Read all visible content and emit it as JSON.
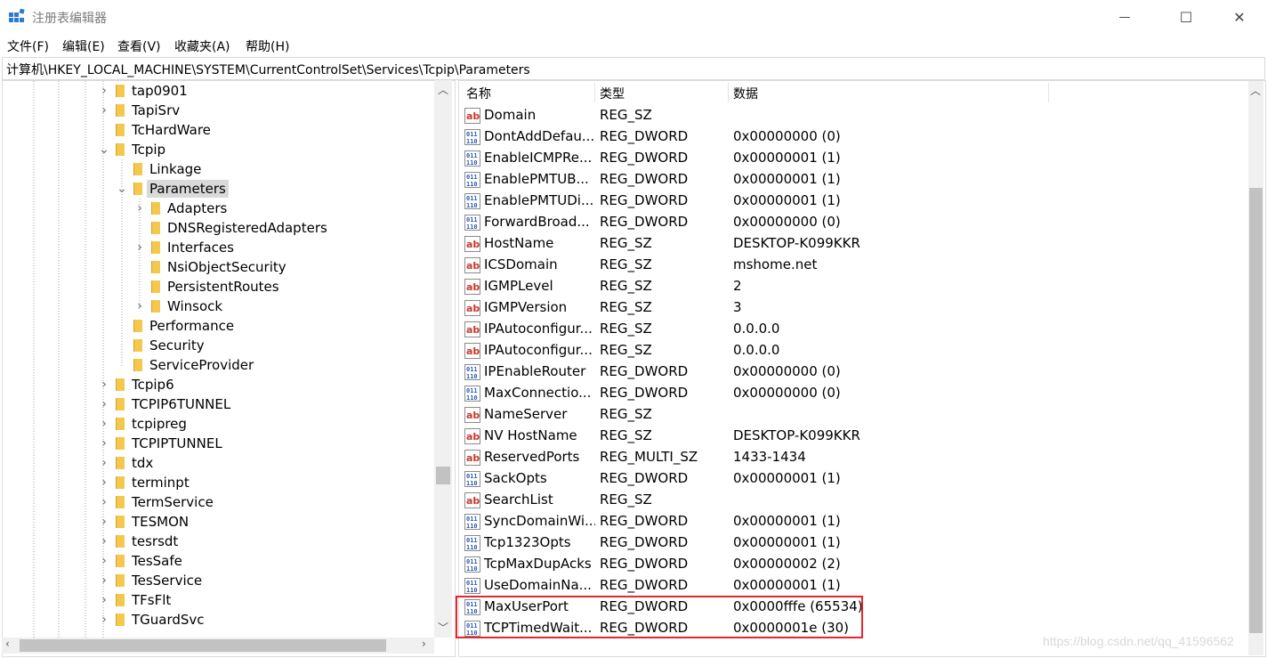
{
  "window": {
    "title": "注册表编辑器",
    "minimize_glyph": "—",
    "maximize_glyph": "☐",
    "close_glyph": "✕"
  },
  "menu": [
    "文件(F)",
    "编辑(E)",
    "查看(V)",
    "收藏夹(A)",
    "帮助(H)"
  ],
  "address": "计算机\\HKEY_LOCAL_MACHINE\\SYSTEM\\CurrentControlSet\\Services\\Tcpip\\Parameters",
  "tree": [
    {
      "label": "tap0901",
      "depth": 0,
      "expander": "collapsed"
    },
    {
      "label": "TapiSrv",
      "depth": 0,
      "expander": "collapsed"
    },
    {
      "label": "TcHardWare",
      "depth": 0,
      "expander": "none"
    },
    {
      "label": "Tcpip",
      "depth": 0,
      "expander": "expanded"
    },
    {
      "label": "Linkage",
      "depth": 1,
      "expander": "none"
    },
    {
      "label": "Parameters",
      "depth": 1,
      "expander": "expanded",
      "selected": true
    },
    {
      "label": "Adapters",
      "depth": 2,
      "expander": "collapsed"
    },
    {
      "label": "DNSRegisteredAdapters",
      "depth": 2,
      "expander": "none"
    },
    {
      "label": "Interfaces",
      "depth": 2,
      "expander": "collapsed"
    },
    {
      "label": "NsiObjectSecurity",
      "depth": 2,
      "expander": "none"
    },
    {
      "label": "PersistentRoutes",
      "depth": 2,
      "expander": "none"
    },
    {
      "label": "Winsock",
      "depth": 2,
      "expander": "collapsed"
    },
    {
      "label": "Performance",
      "depth": 1,
      "expander": "none"
    },
    {
      "label": "Security",
      "depth": 1,
      "expander": "none"
    },
    {
      "label": "ServiceProvider",
      "depth": 1,
      "expander": "none"
    },
    {
      "label": "Tcpip6",
      "depth": 0,
      "expander": "collapsed"
    },
    {
      "label": "TCPIP6TUNNEL",
      "depth": 0,
      "expander": "collapsed"
    },
    {
      "label": "tcpipreg",
      "depth": 0,
      "expander": "collapsed"
    },
    {
      "label": "TCPIPTUNNEL",
      "depth": 0,
      "expander": "collapsed"
    },
    {
      "label": "tdx",
      "depth": 0,
      "expander": "collapsed"
    },
    {
      "label": "terminpt",
      "depth": 0,
      "expander": "collapsed"
    },
    {
      "label": "TermService",
      "depth": 0,
      "expander": "collapsed"
    },
    {
      "label": "TESMON",
      "depth": 0,
      "expander": "collapsed"
    },
    {
      "label": "tesrsdt",
      "depth": 0,
      "expander": "collapsed"
    },
    {
      "label": "TesSafe",
      "depth": 0,
      "expander": "collapsed"
    },
    {
      "label": "TesService",
      "depth": 0,
      "expander": "collapsed"
    },
    {
      "label": "TFsFlt",
      "depth": 0,
      "expander": "collapsed"
    },
    {
      "label": "TGuardSvc",
      "depth": 0,
      "expander": "collapsed"
    }
  ],
  "list_headers": {
    "name": "名称",
    "type": "类型",
    "data": "数据"
  },
  "values": [
    {
      "name": "Domain",
      "type": "REG_SZ",
      "data": "",
      "kind": "sz"
    },
    {
      "name": "DontAddDefau...",
      "type": "REG_DWORD",
      "data": "0x00000000 (0)",
      "kind": "dword"
    },
    {
      "name": "EnableICMPRe...",
      "type": "REG_DWORD",
      "data": "0x00000001 (1)",
      "kind": "dword"
    },
    {
      "name": "EnablePMTUB...",
      "type": "REG_DWORD",
      "data": "0x00000001 (1)",
      "kind": "dword"
    },
    {
      "name": "EnablePMTUDi...",
      "type": "REG_DWORD",
      "data": "0x00000001 (1)",
      "kind": "dword"
    },
    {
      "name": "ForwardBroad...",
      "type": "REG_DWORD",
      "data": "0x00000000 (0)",
      "kind": "dword"
    },
    {
      "name": "HostName",
      "type": "REG_SZ",
      "data": "DESKTOP-K099KKR",
      "kind": "sz"
    },
    {
      "name": "ICSDomain",
      "type": "REG_SZ",
      "data": "mshome.net",
      "kind": "sz"
    },
    {
      "name": "IGMPLevel",
      "type": "REG_SZ",
      "data": "2",
      "kind": "sz"
    },
    {
      "name": "IGMPVersion",
      "type": "REG_SZ",
      "data": "3",
      "kind": "sz"
    },
    {
      "name": "IPAutoconfigur...",
      "type": "REG_SZ",
      "data": "0.0.0.0",
      "kind": "sz"
    },
    {
      "name": "IPAutoconfigur...",
      "type": "REG_SZ",
      "data": "0.0.0.0",
      "kind": "sz"
    },
    {
      "name": "IPEnableRouter",
      "type": "REG_DWORD",
      "data": "0x00000000 (0)",
      "kind": "dword"
    },
    {
      "name": "MaxConnectio...",
      "type": "REG_DWORD",
      "data": "0x00000000 (0)",
      "kind": "dword"
    },
    {
      "name": "NameServer",
      "type": "REG_SZ",
      "data": "",
      "kind": "sz"
    },
    {
      "name": "NV HostName",
      "type": "REG_SZ",
      "data": "DESKTOP-K099KKR",
      "kind": "sz"
    },
    {
      "name": "ReservedPorts",
      "type": "REG_MULTI_SZ",
      "data": "1433-1434",
      "kind": "sz"
    },
    {
      "name": "SackOpts",
      "type": "REG_DWORD",
      "data": "0x00000001 (1)",
      "kind": "dword"
    },
    {
      "name": "SearchList",
      "type": "REG_SZ",
      "data": "",
      "kind": "sz"
    },
    {
      "name": "SyncDomainWi...",
      "type": "REG_DWORD",
      "data": "0x00000001 (1)",
      "kind": "dword"
    },
    {
      "name": "Tcp1323Opts",
      "type": "REG_DWORD",
      "data": "0x00000001 (1)",
      "kind": "dword"
    },
    {
      "name": "TcpMaxDupAcks",
      "type": "REG_DWORD",
      "data": "0x00000002 (2)",
      "kind": "dword"
    },
    {
      "name": "UseDomainNa...",
      "type": "REG_DWORD",
      "data": "0x00000001 (1)",
      "kind": "dword"
    },
    {
      "name": "MaxUserPort",
      "type": "REG_DWORD",
      "data": "0x0000fffe (65534)",
      "kind": "dword"
    },
    {
      "name": "TCPTimedWait...",
      "type": "REG_DWORD",
      "data": "0x0000001e (30)",
      "kind": "dword"
    }
  ],
  "watermark": "https://blog.csdn.net/qq_41596562",
  "colors": {
    "highlight": "#e8262e",
    "folder": "#f4c84d",
    "selection": "#d9d9d9"
  }
}
